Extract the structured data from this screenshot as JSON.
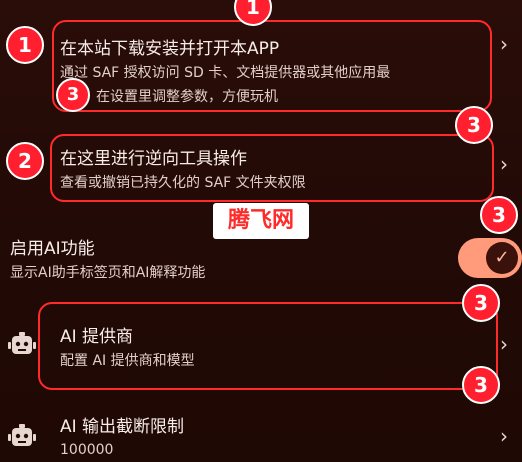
{
  "items": [
    {
      "title": "在本站下载安装并打开本APP",
      "subtitle_line1": "通过 SAF 授权访问 SD 卡、文档提供器或其他应用最",
      "subtitle_line2": "在设置里调整参数，方便玩机"
    },
    {
      "title": "在这里进行逆向工具操作",
      "subtitle": "查看或撤销已持久化的 SAF 文件夹权限"
    }
  ],
  "ai_toggle": {
    "title": "启用AI功能",
    "subtitle": "显示AI助手标签页和AI解释功能",
    "enabled": true,
    "check_icon": "check-icon"
  },
  "ai_provider": {
    "title": "AI 提供商",
    "subtitle": "配置 AI 提供商和模型",
    "icon": "robot-icon"
  },
  "ai_limit": {
    "title": "AI 输出截断限制",
    "value": "100000",
    "icon": "robot-icon"
  },
  "badges": {
    "b1": "1",
    "b2": "1",
    "b3": "2",
    "b4": "3",
    "b5": "3",
    "b6": "3",
    "b7": "3",
    "b8": "3"
  },
  "watermark": "腾飞网",
  "colors": {
    "background": "#240b07",
    "highlight": "#ff2b2b",
    "badge": "#ff1f2e",
    "toggle_track": "#ff9a7a"
  }
}
